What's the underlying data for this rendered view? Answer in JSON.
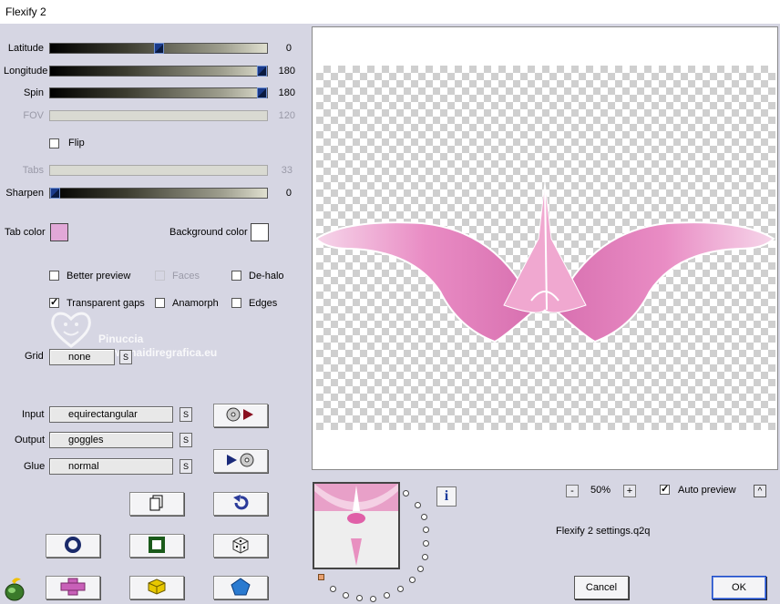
{
  "window": {
    "title": "Flexify 2"
  },
  "sliders": {
    "latitude": {
      "label": "Latitude",
      "value": "0"
    },
    "longitude": {
      "label": "Longitude",
      "value": "180"
    },
    "spin": {
      "label": "Spin",
      "value": "180"
    },
    "fov": {
      "label": "FOV",
      "value": "120"
    },
    "tabs": {
      "label": "Tabs",
      "value": "33"
    },
    "sharpen": {
      "label": "Sharpen",
      "value": "0"
    }
  },
  "flip": {
    "label": "Flip"
  },
  "colors": {
    "tab_color_label": "Tab color",
    "tab_color": "#e2a8d8",
    "background_color_label": "Background color",
    "background_color": "#ffffff"
  },
  "options": {
    "better_preview": "Better preview",
    "faces": "Faces",
    "de_halo": "De-halo",
    "transparent_gaps": "Transparent gaps",
    "anamorph": "Anamorph",
    "edges": "Edges"
  },
  "watermark": {
    "name": "Pinuccia",
    "site": "www.maidiregrafica.eu"
  },
  "grid": {
    "label": "Grid",
    "value": "none",
    "button": "S"
  },
  "projection": {
    "input_label": "Input",
    "input_value": "equirectangular",
    "output_label": "Output",
    "output_value": "goggles",
    "glue_label": "Glue",
    "glue_value": "normal",
    "s_label": "S"
  },
  "zoom": {
    "minus": "-",
    "value": "50%",
    "plus": "+"
  },
  "auto_preview": {
    "label": "Auto preview"
  },
  "settings_file": "Flexify 2 settings.q2q",
  "info_label": "i",
  "caret_label": "^",
  "buttons": {
    "cancel": "Cancel",
    "ok": "OK"
  },
  "accent_colors": {
    "pink": "#e47fb8",
    "slider_thumb": "#1a3a8a"
  }
}
